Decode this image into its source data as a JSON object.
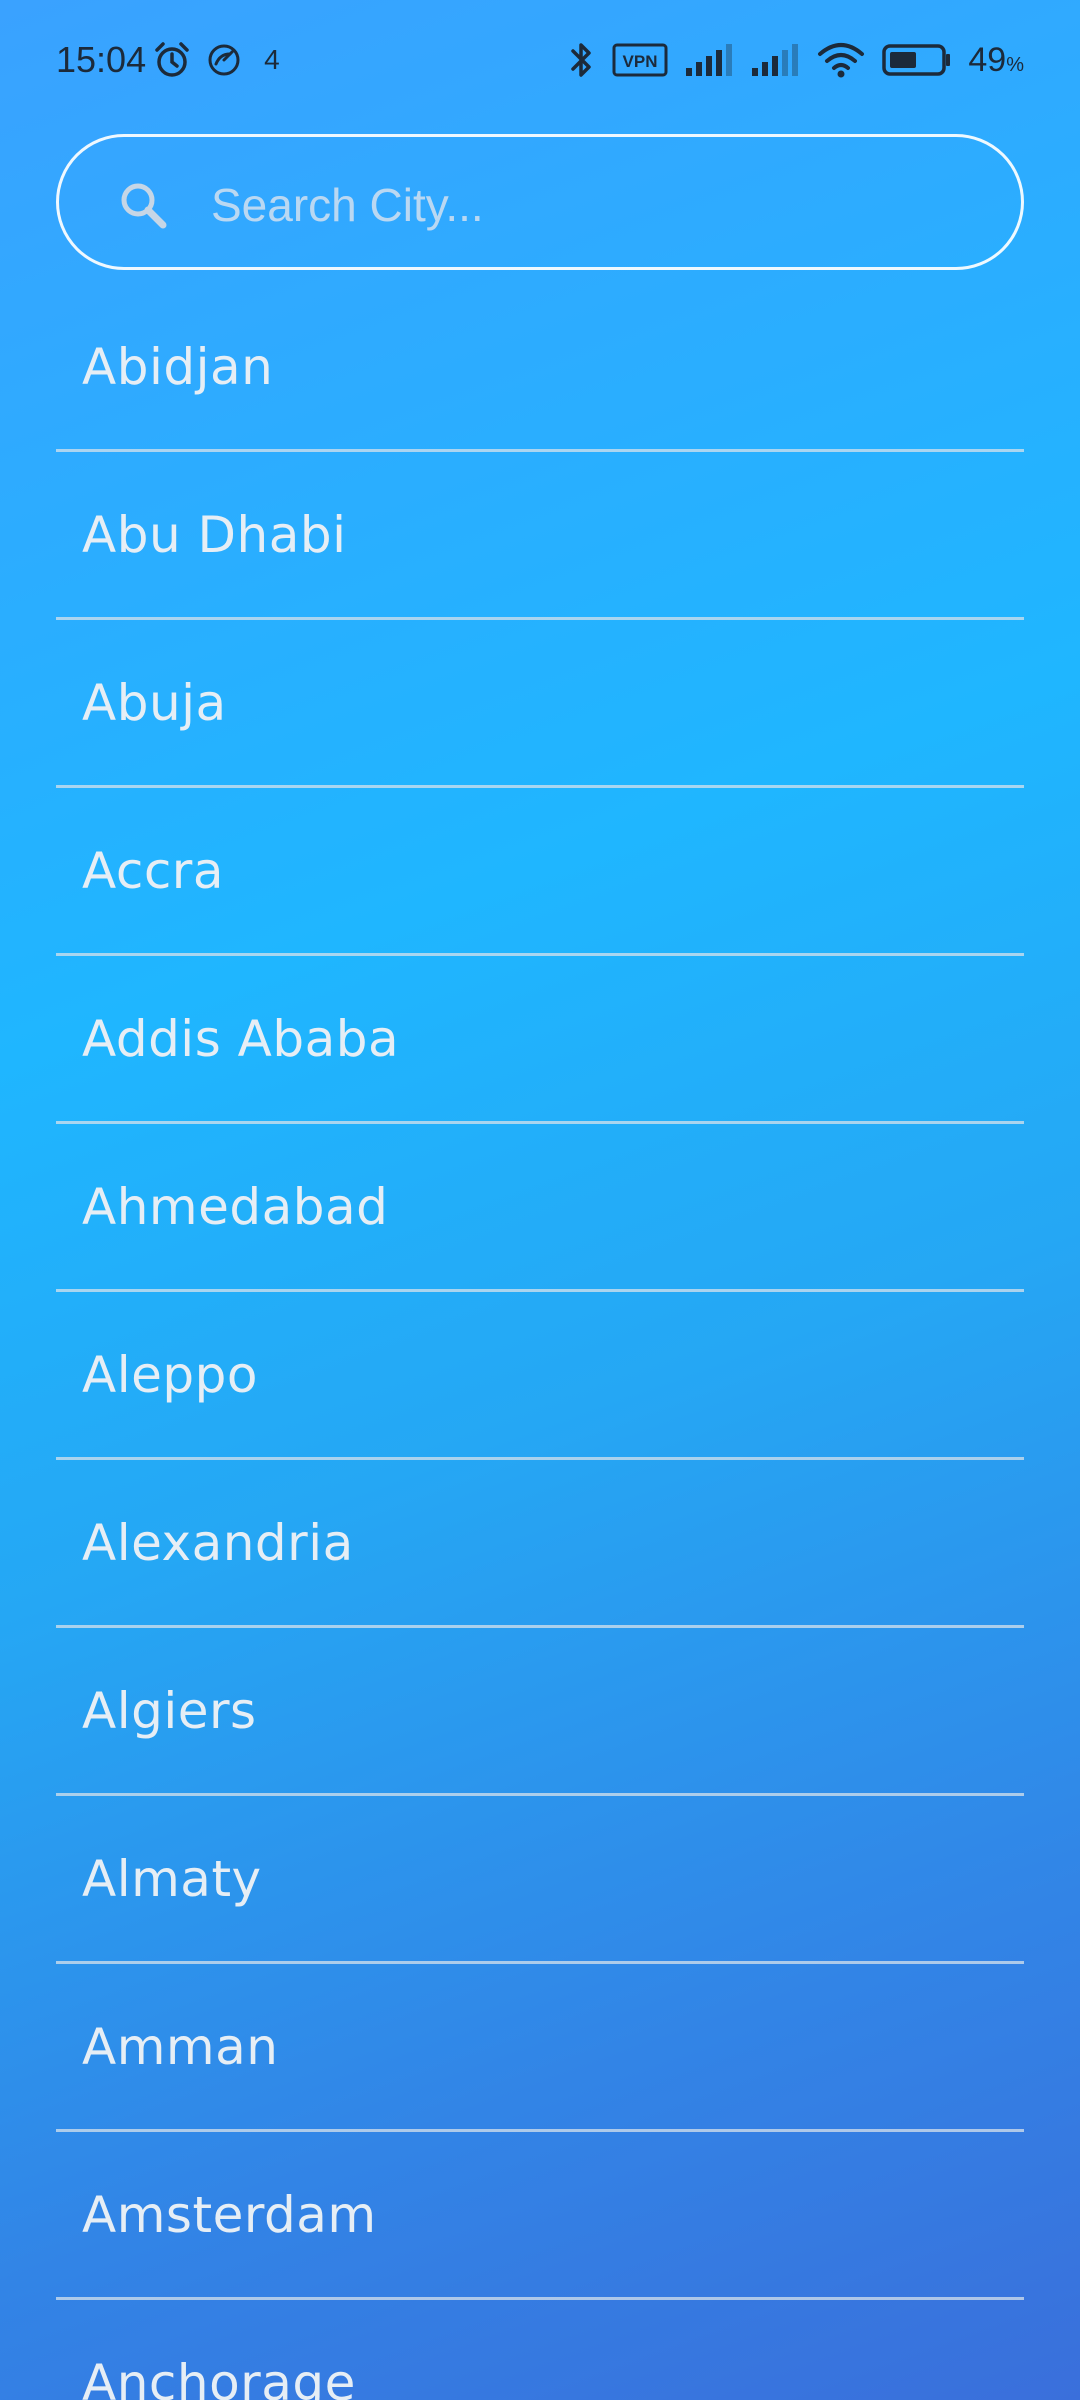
{
  "status_bar": {
    "time": "15:04",
    "notification_count": "4",
    "battery_level": "49",
    "battery_unit": "%",
    "icons": [
      "alarm-icon",
      "data-saver-icon",
      "bluetooth-icon",
      "vpn-icon",
      "signal-icon",
      "signal-icon",
      "wifi-icon",
      "battery-icon"
    ],
    "vpn_label": "VPN"
  },
  "search": {
    "placeholder": "Search City...",
    "value": "",
    "icon": "search-icon"
  },
  "cities": [
    "Abidjan",
    "Abu Dhabi",
    "Abuja",
    "Accra",
    "Addis Ababa",
    "Ahmedabad",
    "Aleppo",
    "Alexandria",
    "Algiers",
    "Almaty",
    "Amman",
    "Amsterdam",
    "Anchorage"
  ],
  "colors": {
    "background_top": "#3aa2ff",
    "background_mid": "#1fb6ff",
    "background_bottom": "#3a6fdb",
    "text": "#e6eef5",
    "divider": "#d7e1eb"
  }
}
